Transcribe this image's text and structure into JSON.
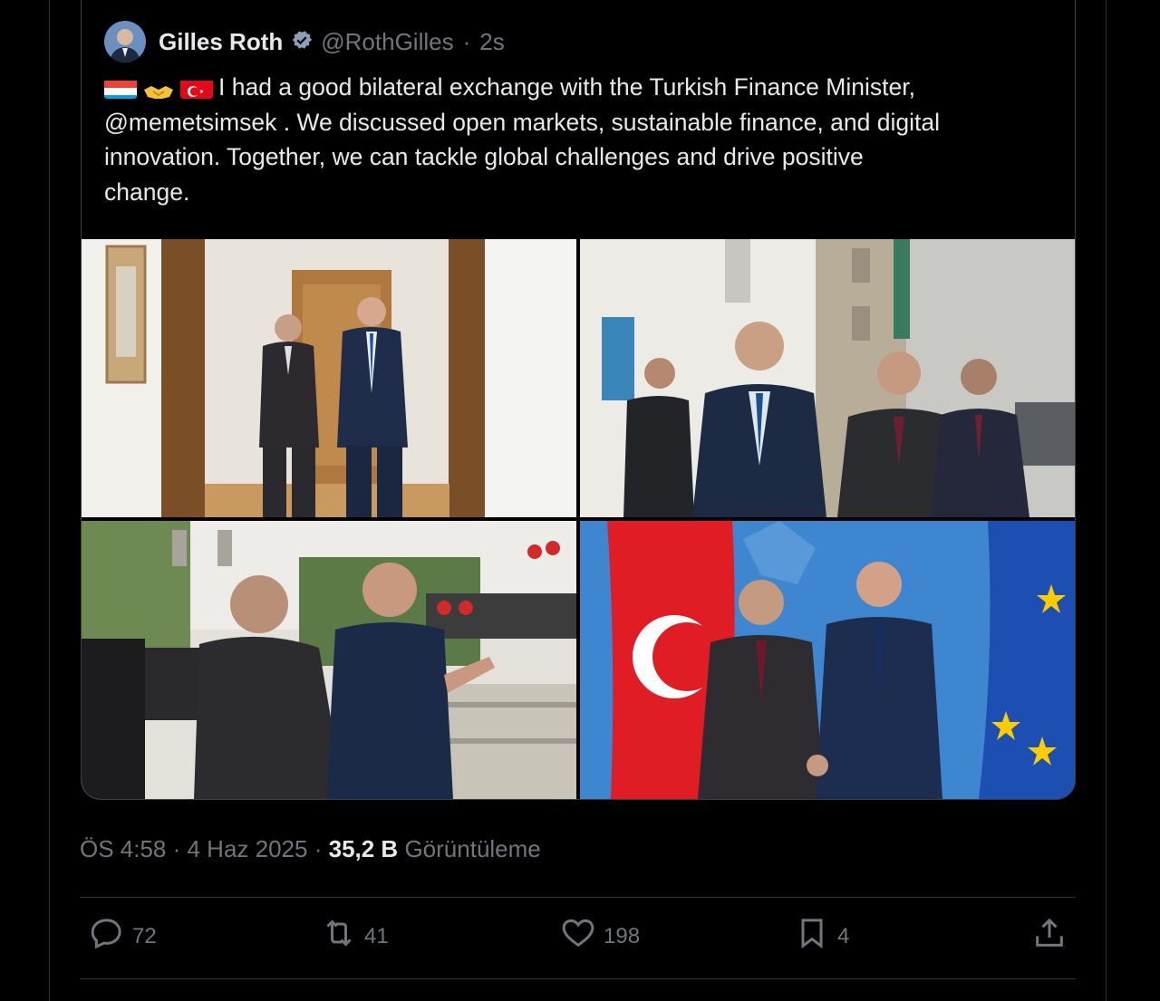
{
  "tweet": {
    "author_name": "Gilles Roth",
    "handle": "@RothGilles",
    "separator": "·",
    "time": "2s",
    "flags_alt": "🇱🇺🫱🇹🇷",
    "text_line1": "I had a good bilateral exchange with the Turkish Finance Minister,",
    "text_line2": "@memetsimsek . We discussed open markets, sustainable finance, and digital",
    "text_line3": "innovation. Together, we can tackle global challenges and drive positive",
    "text_line4": "change."
  },
  "meta": {
    "timestamp": "ÖS 4:58 · 4 Haz 2025 ·",
    "views_count": "35,2 B",
    "views_label": "Görüntüleme"
  },
  "actions": {
    "replies": "72",
    "reposts": "41",
    "likes": "198",
    "bookmarks": "4"
  },
  "icons": [
    "verified-icon",
    "reply-icon",
    "repost-icon",
    "like-icon",
    "bookmark-icon",
    "share-icon"
  ],
  "colors": {
    "verified": "#8ba0b5",
    "muted": "#71767b",
    "text": "#e7e9ea",
    "border": "#2f3336"
  }
}
